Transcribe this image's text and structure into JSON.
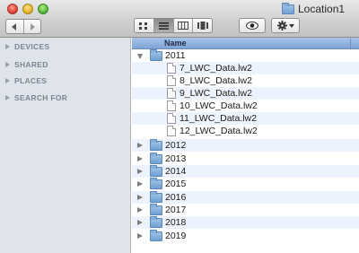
{
  "window": {
    "title": "Location1"
  },
  "sidebar": {
    "sections": [
      {
        "label": "DEVICES"
      },
      {
        "label": "SHARED"
      },
      {
        "label": "PLACES"
      },
      {
        "label": "SEARCH FOR"
      }
    ]
  },
  "list": {
    "column_header": "Name",
    "rows": [
      {
        "type": "folder",
        "name": "2011",
        "expanded": true
      },
      {
        "type": "file",
        "name": "7_LWC_Data.lw2"
      },
      {
        "type": "file",
        "name": "8_LWC_Data.lw2"
      },
      {
        "type": "file",
        "name": "9_LWC_Data.lw2"
      },
      {
        "type": "file",
        "name": "10_LWC_Data.lw2"
      },
      {
        "type": "file",
        "name": "11_LWC_Data.lw2"
      },
      {
        "type": "file",
        "name": "12_LWC_Data.lw2"
      },
      {
        "type": "folder",
        "name": "2012",
        "expanded": false
      },
      {
        "type": "folder",
        "name": "2013",
        "expanded": false
      },
      {
        "type": "folder",
        "name": "2014",
        "expanded": false
      },
      {
        "type": "folder",
        "name": "2015",
        "expanded": false
      },
      {
        "type": "folder",
        "name": "2016",
        "expanded": false
      },
      {
        "type": "folder",
        "name": "2017",
        "expanded": false
      },
      {
        "type": "folder",
        "name": "2018",
        "expanded": false
      },
      {
        "type": "folder",
        "name": "2019",
        "expanded": false
      }
    ]
  },
  "colors": {
    "header_blue": "#7ea3d6",
    "stripe": "#edf3fe",
    "sidebar_bg": "#dfe4eb"
  }
}
